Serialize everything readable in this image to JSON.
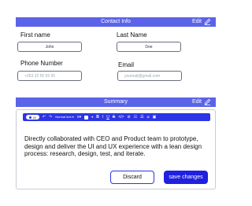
{
  "contact": {
    "title": "Contact Info",
    "edit_label": "Edit",
    "first_name_label": "First name",
    "first_name_value": "John",
    "last_name_label": "Last Name",
    "last_name_value": "Doe",
    "phone_label": "Phone Number",
    "phone_placeholder": "+353 22 55 55 55",
    "email_label": "Email",
    "email_placeholder": "youmail@gmail.com"
  },
  "summary": {
    "title": "Summary",
    "edit_label": "Edit",
    "toolbar": {
      "ai_label": "AI",
      "text_style": "Normal text"
    },
    "body": "Directly collaborated with CEO and Product team to prototype, design and deliver the UI and UX experience with a lean design process: research, design, test, and iterate.",
    "discard_label": "Discard",
    "save_label": "save changes"
  },
  "colors": {
    "bar": "#5b63e8",
    "toolbar": "#2c35e6",
    "primary_button": "#2020e0"
  }
}
